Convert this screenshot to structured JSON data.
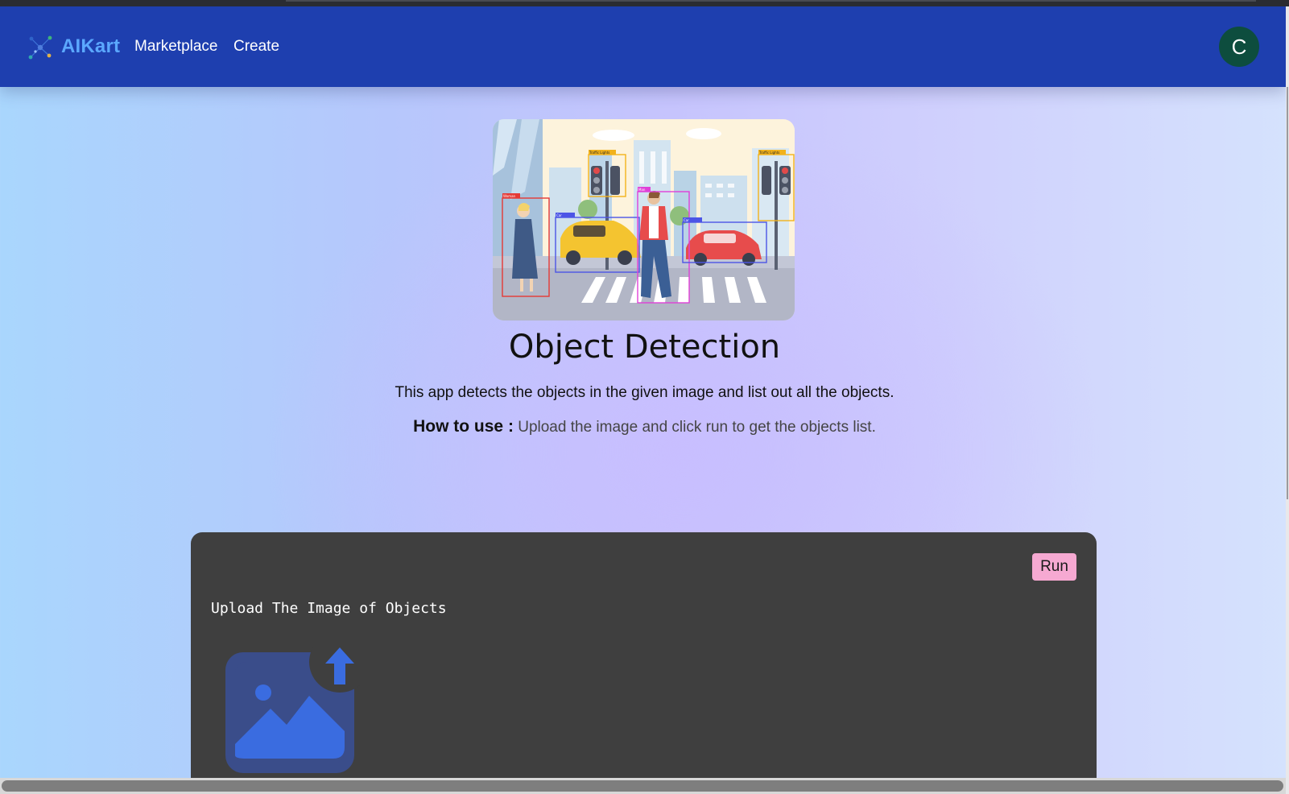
{
  "navbar": {
    "brand": "AIKart",
    "links": [
      "Marketplace",
      "Create"
    ],
    "avatar_initial": "C",
    "logo_icon": "network-dots-icon"
  },
  "app": {
    "title": "Object Detection",
    "description": "This app detects the objects in the given image and list out all the objects.",
    "how_to_label": "How to use :",
    "how_to_text": "Upload the image and click run to get the objects list.",
    "hero_labels": [
      "Woman",
      "Traffic Lights",
      "Car",
      "Man",
      "Car",
      "Traffic Lights"
    ]
  },
  "panel": {
    "run_label": "Run",
    "upload_label": "Upload The Image of Objects",
    "upload_icon": "image-upload-icon"
  },
  "colors": {
    "navbar": "#1e3faf",
    "brand": "#5ba8ff",
    "avatar": "#0d4d3e",
    "panel": "#3f3f3f",
    "run_button": "#f6a9d2",
    "upload_icon": "#3a6ce0"
  }
}
